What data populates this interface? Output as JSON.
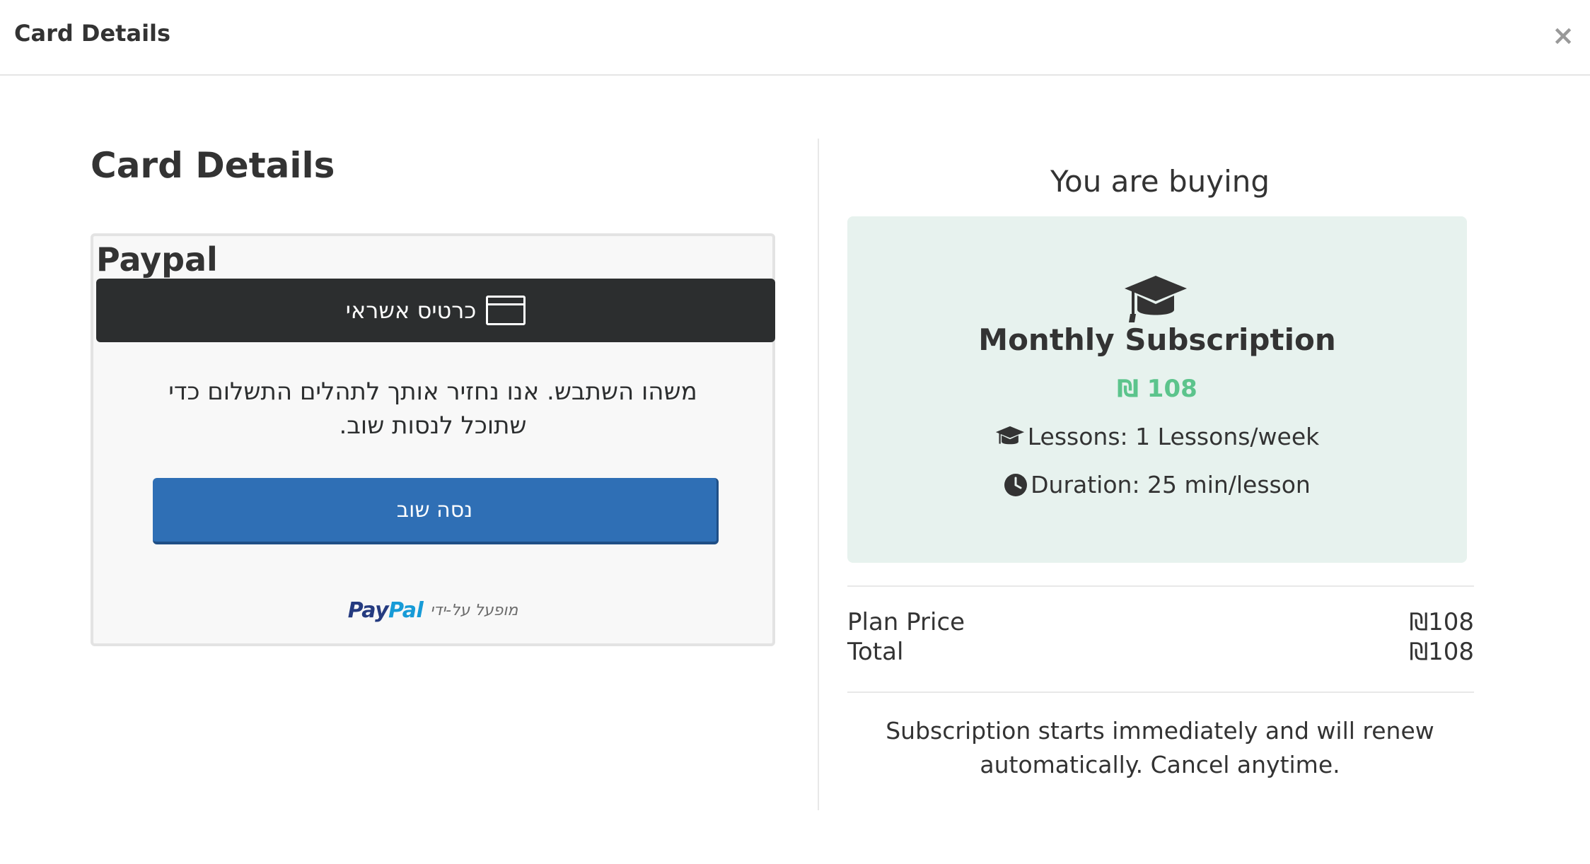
{
  "modal": {
    "title": "Card Details",
    "close_symbol": "×"
  },
  "left": {
    "heading": "Card Details",
    "provider_title": "Paypal",
    "card_button_label": "כרטיס אשראי",
    "error_message": "משהו השתבש. אנו נחזיר אותך לתהלים התשלום כדי שתוכל לנסות שוב.",
    "retry_label": "נסה שוב",
    "powered_by_text": "מופעל על-ידי",
    "paypal_logo_pay": "Pay",
    "paypal_logo_pal": "Pal"
  },
  "right": {
    "title": "You are buying",
    "plan_name": "Monthly Subscription",
    "plan_price": "₪ 108",
    "lessons": "Lessons: 1 Lessons/week",
    "duration": "Duration: 25 min/lesson",
    "plan_price_label": "Plan Price",
    "plan_price_value": "₪108",
    "total_label": "Total",
    "total_value": "₪108",
    "note": "Subscription starts immediately and will renew automatically. Cancel anytime."
  },
  "icons": {
    "close": "close-icon",
    "card": "credit-card-icon",
    "cap": "graduation-cap-icon",
    "clock": "clock-icon"
  },
  "colors": {
    "paypal_blue_button": "#2f6fb5",
    "card_button_dark": "#2c2e2f",
    "plan_card_bg": "#e7f2ee",
    "price_green": "#5cc48c"
  }
}
